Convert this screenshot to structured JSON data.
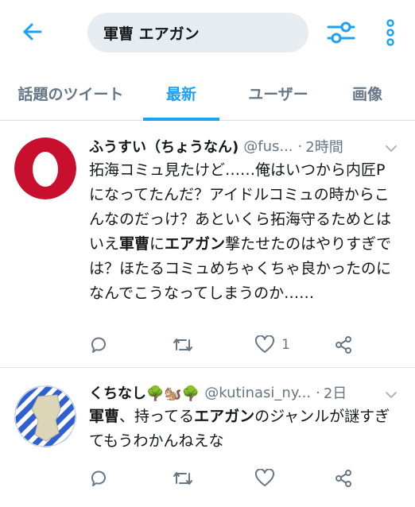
{
  "search": {
    "query": "軍曹 エアガン"
  },
  "tabs": [
    {
      "label": "話題のツイート"
    },
    {
      "label": "最新"
    },
    {
      "label": "ユーザー"
    },
    {
      "label": "画像"
    }
  ],
  "tweets": [
    {
      "name": "ふうすい（ちょうなん)",
      "handle": "@fus...",
      "dot": "·",
      "time": "2時間",
      "body": [
        {
          "t": "拓海コミュ見たけど……俺はいつから内匠Pになってたんだ？アイドルコミュの時からこんなのだっけ？あといくら拓海守るためとはいえ"
        },
        {
          "t": "軍曹",
          "b": true
        },
        {
          "t": "に"
        },
        {
          "t": "エアガン",
          "b": true
        },
        {
          "t": "撃たせたのはやりすぎでは？ほたるコミュめちゃくちゃ良かったのになんでこうなってしまうのか……"
        }
      ],
      "like_count": "1"
    },
    {
      "name": "くちなし🌳🐿️🌳",
      "handle": "@kutinasi_ny...",
      "dot": "·",
      "time": "2日",
      "body": [
        {
          "t": "軍曹",
          "b": true
        },
        {
          "t": "、持ってる"
        },
        {
          "t": "エアガン",
          "b": true
        },
        {
          "t": "のジャンルが謎すぎてもうわかんねえな"
        }
      ],
      "like_count": ""
    }
  ],
  "colors": {
    "accent": "#1da1f2",
    "muted": "#657786",
    "avatar1_ring": "#c8102e"
  }
}
